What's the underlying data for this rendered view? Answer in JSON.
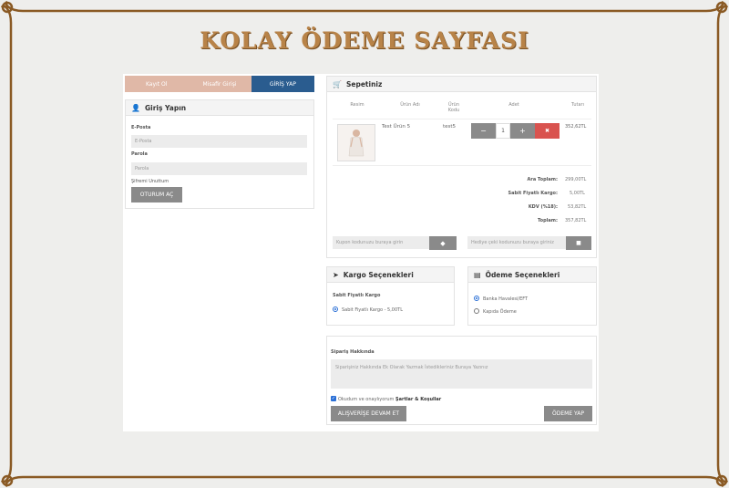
{
  "page": {
    "title": "KOLAY ÖDEME SAYFASI"
  },
  "tabs": {
    "signup": "Kayıt Ol",
    "guest": "Misafir Girişi",
    "login": "GİRİŞ YAP"
  },
  "login": {
    "title": "Giriş Yapın",
    "email_label": "E-Posta",
    "email_placeholder": "E-Posta",
    "password_label": "Parola",
    "password_placeholder": "Parola",
    "forgot": "Şifremi Unuttum",
    "submit": "OTURUM AÇ"
  },
  "cart": {
    "title": "Sepetiniz",
    "headers": {
      "image": "Resim",
      "name": "Ürün Adı",
      "code": "Ürün Kodu",
      "qty": "Adet",
      "total": "Tutarı"
    },
    "item": {
      "name": "Test Ürün 5",
      "code": "test5",
      "qty": "1",
      "total": "352,62TL",
      "minus": "−",
      "plus": "+",
      "remove": "✖"
    },
    "summary": [
      {
        "label": "Ara Toplam:",
        "value": "299,00TL"
      },
      {
        "label": "Sabit Fiyatlı Kargo:",
        "value": "5,00TL"
      },
      {
        "label": "KDV (%18):",
        "value": "53,82TL"
      },
      {
        "label": "Toplam:",
        "value": "357,82TL"
      }
    ],
    "coupon_placeholder": "Kupon kodunuzu buraya girin",
    "gift_placeholder": "Hediye çeki kodunuzu buraya giriniz"
  },
  "shipping": {
    "title": "Kargo Seçenekleri",
    "subtitle": "Sabit Fiyatlı Kargo",
    "option": "Sabit Fiyatlı Kargo - 5,00TL"
  },
  "payment": {
    "title": "Ödeme Seçenekleri",
    "options": [
      "Banka Havalesi/EFT",
      "Kapıda Ödeme"
    ]
  },
  "order": {
    "title": "Sipariş Hakkında",
    "note_placeholder": "Siparişiniz Hakkında Ek Olarak Yazmak İstedikleriniz Buraya Yazınız",
    "terms_prefix": "Okudum ve onaylıyorum",
    "terms_link": "Şartlar & Koşullar",
    "continue": "ALIŞVERİŞE DEVAM ET",
    "pay": "ÖDEME YAP"
  },
  "colors": {
    "frame": "#8a5a24",
    "accent_blue": "#2a5c8f",
    "tab_pink": "#e0b8a7",
    "remove_red": "#d9534f",
    "title_gold": "#b88348"
  }
}
